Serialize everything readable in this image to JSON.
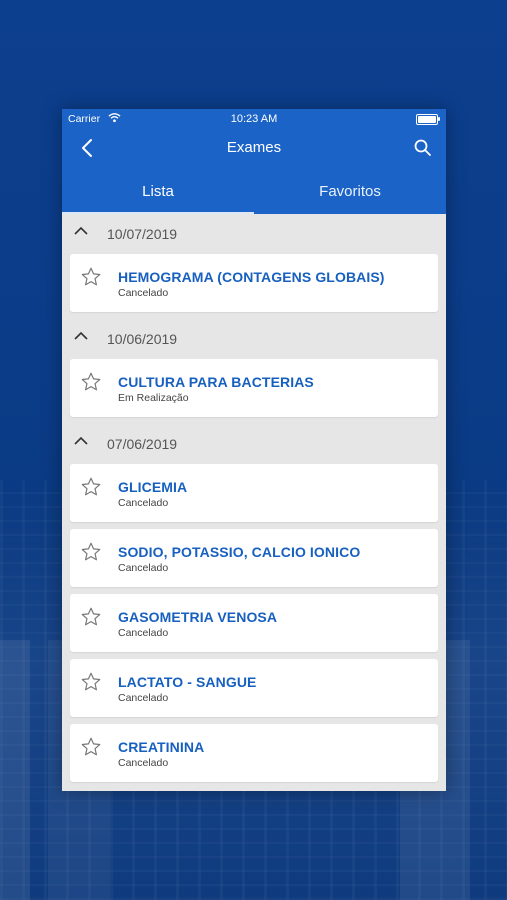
{
  "status_bar": {
    "carrier": "Carrier",
    "time": "10:23 AM"
  },
  "navbar": {
    "title": "Exames"
  },
  "tabs": [
    {
      "label": "Lista"
    },
    {
      "label": "Favoritos"
    }
  ],
  "groups": [
    {
      "date": "10/07/2019",
      "items": [
        {
          "name": "HEMOGRAMA (CONTAGENS GLOBAIS)",
          "status": "Cancelado"
        }
      ]
    },
    {
      "date": "10/06/2019",
      "items": [
        {
          "name": "CULTURA PARA BACTERIAS",
          "status": "Em Realização"
        }
      ]
    },
    {
      "date": "07/06/2019",
      "items": [
        {
          "name": "GLICEMIA",
          "status": "Cancelado"
        },
        {
          "name": "SODIO, POTASSIO, CALCIO IONICO",
          "status": "Cancelado"
        },
        {
          "name": "GASOMETRIA VENOSA",
          "status": "Cancelado"
        },
        {
          "name": "LACTATO - SANGUE",
          "status": "Cancelado"
        },
        {
          "name": "CREATININA",
          "status": "Cancelado"
        }
      ]
    }
  ],
  "colors": {
    "brand": "#1b63c6",
    "exam_title": "#1760c0",
    "list_bg": "#e6e6e6"
  }
}
